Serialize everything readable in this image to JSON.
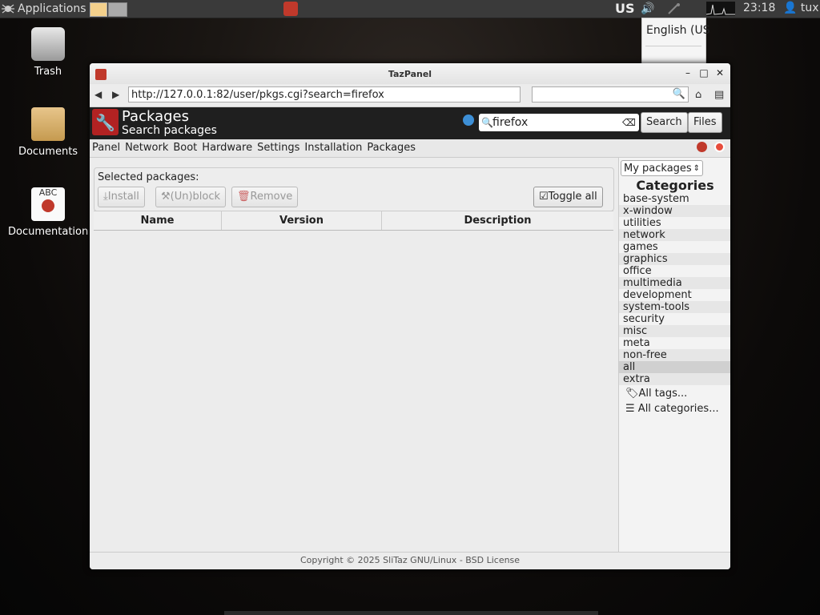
{
  "taskbar": {
    "apps_label": "Applications",
    "layout": "US",
    "clock": "23:18",
    "user": "tux"
  },
  "kb_popup": {
    "label": "English (US"
  },
  "desktop": {
    "icons": [
      {
        "label": "Trash"
      },
      {
        "label": "Documents"
      },
      {
        "label": "Documentation",
        "art_text": "ABC"
      }
    ]
  },
  "window": {
    "title": "TazPanel",
    "url": "http://127.0.0.1:82/user/pkgs.cgi?search=firefox",
    "header": {
      "title": "Packages",
      "subtitle": "Search packages"
    },
    "search_value": "firefox",
    "search_button": "Search",
    "files_button": "Files",
    "menu": [
      "Panel",
      "Network",
      "Boot",
      "Hardware",
      "Settings",
      "Installation",
      "Packages"
    ],
    "selected": {
      "label": "Selected packages:",
      "install": "Install",
      "unblock": "(Un)block",
      "remove": "Remove",
      "toggle": "Toggle all"
    },
    "table_headers": [
      "Name",
      "Version",
      "Description"
    ],
    "filter_select": "My packages",
    "categories_title": "Categories",
    "categories": [
      "base-system",
      "x-window",
      "utilities",
      "network",
      "games",
      "graphics",
      "office",
      "multimedia",
      "development",
      "system-tools",
      "security",
      "misc",
      "meta",
      "non-free",
      "all",
      "extra"
    ],
    "selected_category": "all",
    "all_tags": "All tags...",
    "all_categories": "All categories...",
    "footer": "Copyright © 2025 SliTaz GNU/Linux - BSD License"
  }
}
